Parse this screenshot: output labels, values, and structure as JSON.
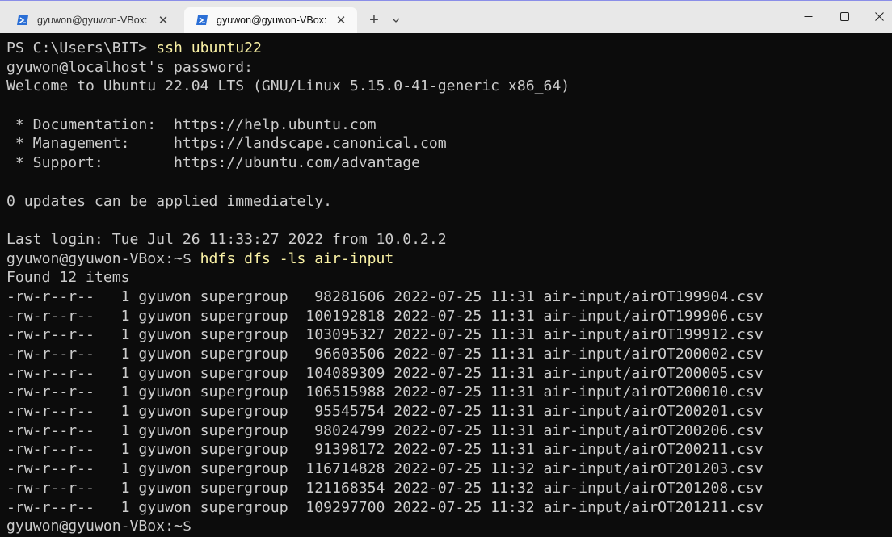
{
  "window": {
    "tabs": [
      {
        "label": "gyuwon@gyuwon-VBox: ~/hiv",
        "active": false,
        "icon": "powershell-icon"
      },
      {
        "label": "gyuwon@gyuwon-VBox: ~",
        "active": true,
        "icon": "powershell-icon"
      }
    ],
    "new_tab_label": "+",
    "close_glyph": "✕",
    "accent_color": "#2b6fd6"
  },
  "terminal": {
    "text_color": "#cccccc",
    "command_color": "#f9f1a5",
    "background": "#0c0c0c",
    "intro": {
      "ps_prompt": "PS C:\\Users\\BIT> ",
      "ps_command": "ssh ubuntu22",
      "password_prompt": "gyuwon@localhost's password:",
      "welcome": "Welcome to Ubuntu 22.04 LTS (GNU/Linux 5.15.0-41-generic x86_64)",
      "doc": " * Documentation:  https://help.ubuntu.com",
      "mgmt": " * Management:     https://landscape.canonical.com",
      "support": " * Support:        https://ubuntu.com/advantage",
      "updates": "0 updates can be applied immediately.",
      "last_login": "Last login: Tue Jul 26 11:33:27 2022 from 10.0.2.2",
      "prompt": "gyuwon@gyuwon-VBox:~$ ",
      "command": "hdfs dfs -ls air-input",
      "found": "Found 12 items"
    },
    "files": [
      {
        "perm": "-rw-r--r--",
        "repl": "1",
        "owner": "gyuwon",
        "group": "supergroup",
        "size": "98281606",
        "date": "2022-07-25",
        "time": "11:31",
        "path": "air-input/airOT199904.csv"
      },
      {
        "perm": "-rw-r--r--",
        "repl": "1",
        "owner": "gyuwon",
        "group": "supergroup",
        "size": "100192818",
        "date": "2022-07-25",
        "time": "11:31",
        "path": "air-input/airOT199906.csv"
      },
      {
        "perm": "-rw-r--r--",
        "repl": "1",
        "owner": "gyuwon",
        "group": "supergroup",
        "size": "103095327",
        "date": "2022-07-25",
        "time": "11:31",
        "path": "air-input/airOT199912.csv"
      },
      {
        "perm": "-rw-r--r--",
        "repl": "1",
        "owner": "gyuwon",
        "group": "supergroup",
        "size": "96603506",
        "date": "2022-07-25",
        "time": "11:31",
        "path": "air-input/airOT200002.csv"
      },
      {
        "perm": "-rw-r--r--",
        "repl": "1",
        "owner": "gyuwon",
        "group": "supergroup",
        "size": "104089309",
        "date": "2022-07-25",
        "time": "11:31",
        "path": "air-input/airOT200005.csv"
      },
      {
        "perm": "-rw-r--r--",
        "repl": "1",
        "owner": "gyuwon",
        "group": "supergroup",
        "size": "106515988",
        "date": "2022-07-25",
        "time": "11:31",
        "path": "air-input/airOT200010.csv"
      },
      {
        "perm": "-rw-r--r--",
        "repl": "1",
        "owner": "gyuwon",
        "group": "supergroup",
        "size": "95545754",
        "date": "2022-07-25",
        "time": "11:31",
        "path": "air-input/airOT200201.csv"
      },
      {
        "perm": "-rw-r--r--",
        "repl": "1",
        "owner": "gyuwon",
        "group": "supergroup",
        "size": "98024799",
        "date": "2022-07-25",
        "time": "11:31",
        "path": "air-input/airOT200206.csv"
      },
      {
        "perm": "-rw-r--r--",
        "repl": "1",
        "owner": "gyuwon",
        "group": "supergroup",
        "size": "91398172",
        "date": "2022-07-25",
        "time": "11:31",
        "path": "air-input/airOT200211.csv"
      },
      {
        "perm": "-rw-r--r--",
        "repl": "1",
        "owner": "gyuwon",
        "group": "supergroup",
        "size": "116714828",
        "date": "2022-07-25",
        "time": "11:32",
        "path": "air-input/airOT201203.csv"
      },
      {
        "perm": "-rw-r--r--",
        "repl": "1",
        "owner": "gyuwon",
        "group": "supergroup",
        "size": "121168354",
        "date": "2022-07-25",
        "time": "11:32",
        "path": "air-input/airOT201208.csv"
      },
      {
        "perm": "-rw-r--r--",
        "repl": "1",
        "owner": "gyuwon",
        "group": "supergroup",
        "size": "109297700",
        "date": "2022-07-25",
        "time": "11:32",
        "path": "air-input/airOT201211.csv"
      }
    ],
    "final_prompt": "gyuwon@gyuwon-VBox:~$ "
  }
}
